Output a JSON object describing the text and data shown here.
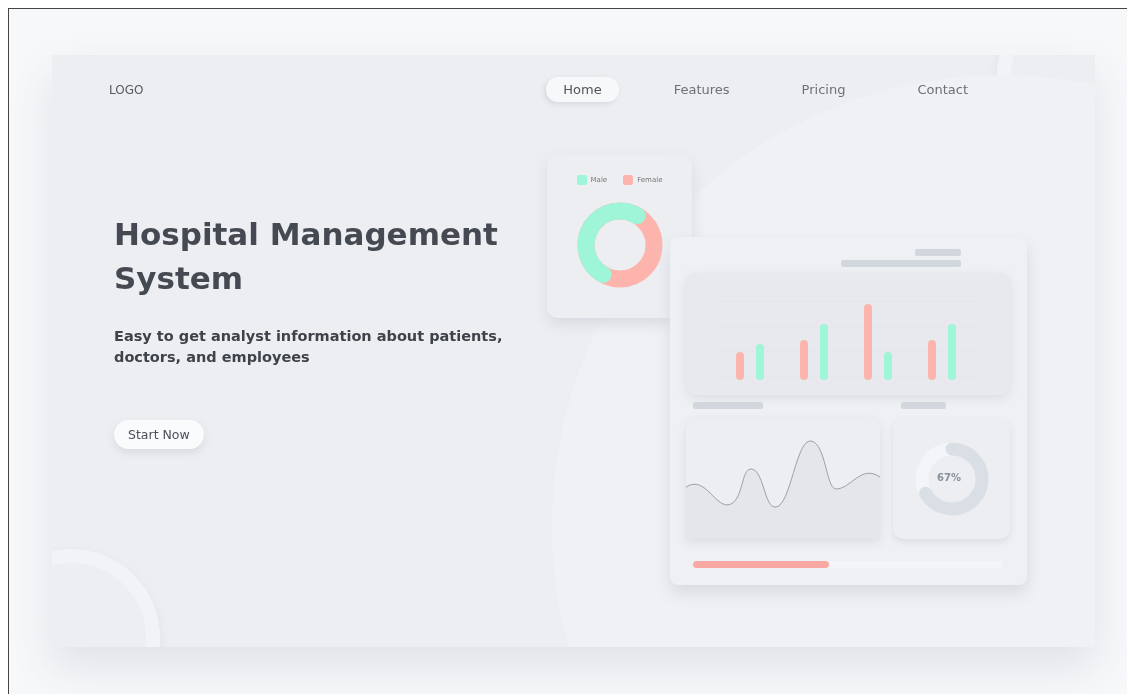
{
  "nav": {
    "logo": "LOGO",
    "links": [
      {
        "label": "Home",
        "selected": true
      },
      {
        "label": "Features",
        "selected": false
      },
      {
        "label": "Pricing",
        "selected": false
      },
      {
        "label": "Contact",
        "selected": false
      }
    ]
  },
  "hero": {
    "title": "Hospital Management System",
    "subtitle": "Easy to get analyst information about patients, doctors, and employees",
    "button": "Start Now"
  },
  "dashboard": {
    "legend": [
      {
        "label": "Male",
        "color": "#9ff5d8"
      },
      {
        "label": "Female",
        "color": "#fdb4ad"
      }
    ],
    "gauge": {
      "level": 0.67,
      "reading": "67%"
    },
    "progress": {
      "level": 0.44
    }
  }
}
